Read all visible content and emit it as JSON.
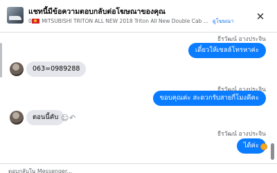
{
  "header": {
    "title": "แชทนี้มีข้อความตอบกลับต่อโฆษณาของคุณ",
    "subtitle_prefix": "0",
    "ad_name": "MITSUBISHI TRITON ALL NEW 2018 Triton All New Double Cab ...",
    "link_label": "ดูโฆษณา",
    "close_glyph": "✕"
  },
  "messages": [
    {
      "direction": "outgoing",
      "sender": "ธีรวัฒน์ อางประจิน",
      "text": "เดี๋ยวให้เซลล์โทรหาค่ะ"
    },
    {
      "direction": "incoming",
      "text": "063=0989288"
    },
    {
      "direction": "outgoing",
      "sender": "ธีรวัฒน์ อางประจิน",
      "text": "ขอบคุณค่ะ สะดวกรับสายกี่โมงคีคะ"
    },
    {
      "direction": "incoming",
      "text": "ตอนนี้คับ"
    },
    {
      "direction": "outgoing",
      "sender": "ธีรวัฒน์ อางประจิน",
      "text": "ได้ค่ะ"
    }
  ],
  "icons": {
    "emoji": "☺",
    "reply": "↶"
  },
  "composer": {
    "placeholder": "ตอบกลับใน Messenger..."
  },
  "colors": {
    "outgoing_bubble": "#0a7cff",
    "incoming_bubble": "#e4e6eb",
    "link": "#1877f2"
  }
}
